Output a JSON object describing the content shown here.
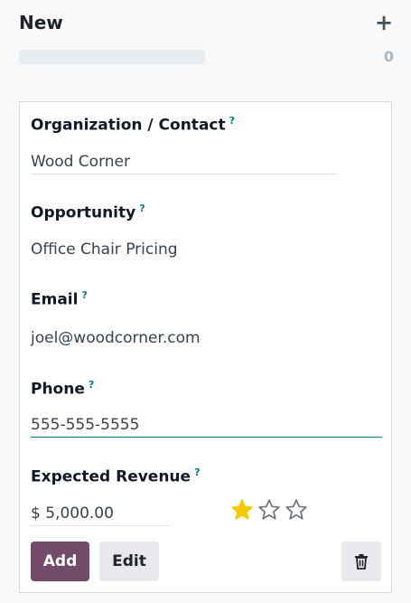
{
  "column": {
    "title": "New",
    "add_icon": "plus-icon",
    "count": "0",
    "progress": 0
  },
  "card": {
    "organization": {
      "label": "Organization / Contact",
      "help": "?",
      "value": "Wood Corner"
    },
    "opportunity": {
      "label": "Opportunity",
      "help": "?",
      "value": "Office Chair Pricing"
    },
    "email": {
      "label": "Email",
      "help": "?",
      "value": "joel@woodcorner.com"
    },
    "phone": {
      "label": "Phone",
      "help": "?",
      "value": "555-555-5555"
    },
    "revenue": {
      "label": "Expected Revenue",
      "help": "?",
      "value": "$ 5,000.00"
    },
    "priority": {
      "max": 3,
      "value": 1,
      "filled_color": "#f3cc00",
      "empty_color": "#6c757d"
    },
    "buttons": {
      "add": "Add",
      "edit": "Edit",
      "delete_icon": "trash-icon"
    }
  },
  "colors": {
    "brand": "#714b67",
    "accent": "#017e84"
  }
}
